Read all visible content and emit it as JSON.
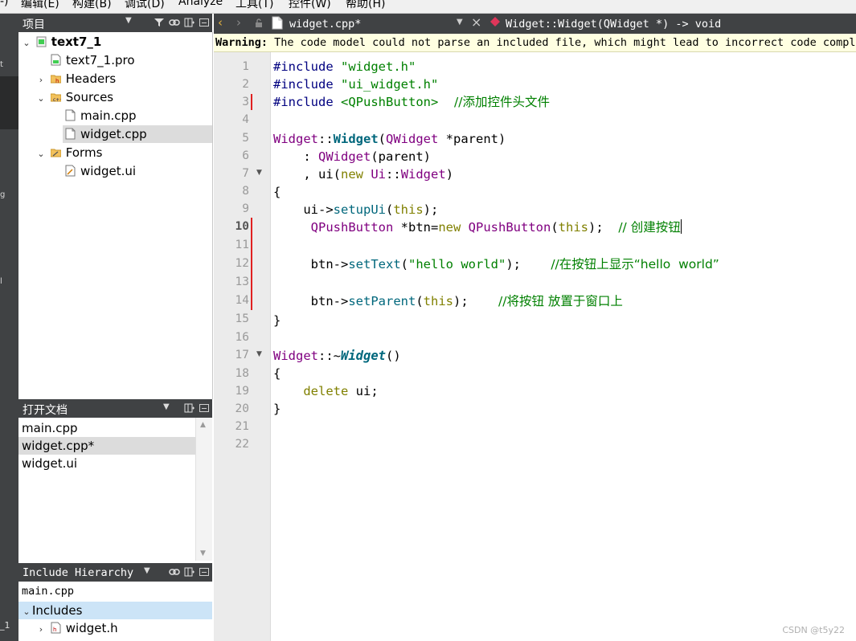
{
  "menu": [
    "-)",
    "编辑(E)",
    "构建(B)",
    "调试(D)",
    "Analyze",
    "工具(T)",
    "控件(W)",
    "帮助(H)"
  ],
  "modebar_fragments": [
    "t",
    "g",
    "l",
    "_1"
  ],
  "project_panel": {
    "title": "项目",
    "tree": [
      {
        "label": "text7_1",
        "bold": true,
        "arrow": "⌄"
      },
      {
        "label": "text7_1.pro",
        "icon": "pro-file-icon"
      },
      {
        "label": "Headers",
        "arrow": "›",
        "icon": "folder-headers-icon"
      },
      {
        "label": "Sources",
        "arrow": "⌄",
        "icon": "folder-sources-icon"
      },
      {
        "label": "main.cpp",
        "icon": "cpp-file-icon"
      },
      {
        "label": "widget.cpp",
        "icon": "cpp-file-icon",
        "selected": true
      },
      {
        "label": "Forms",
        "arrow": "⌄",
        "icon": "folder-forms-icon"
      },
      {
        "label": "widget.ui",
        "icon": "ui-file-icon"
      }
    ]
  },
  "open_docs": {
    "title": "打开文档",
    "items": [
      {
        "label": "main.cpp"
      },
      {
        "label": "widget.cpp*",
        "selected": true
      },
      {
        "label": "widget.ui"
      }
    ]
  },
  "include_hierarchy": {
    "title": "Include Hierarchy",
    "file": "main.cpp",
    "includes_label": "Includes",
    "child": "widget.h"
  },
  "editor": {
    "file_tab": "widget.cpp*",
    "symbol": "Widget::Widget(QWidget *) -> void",
    "warning_bold": "Warning:",
    "warning_text": " The code model could not parse an included file, which might lead to incorrect code completion",
    "current_line": 10,
    "line_numbers": [
      "1",
      "2",
      "3",
      "4",
      "5",
      "6",
      "7",
      "8",
      "9",
      "10",
      "11",
      "12",
      "13",
      "14",
      "15",
      "16",
      "17",
      "18",
      "19",
      "20",
      "21",
      "22"
    ],
    "code": {
      "l1_pp": "#include ",
      "l1_str": "\"widget.h\"",
      "l2_pp": "#include ",
      "l2_str": "\"ui_widget.h\"",
      "l3_pp": "#include ",
      "l3_str": "<QPushButton>",
      "l3_cm": "    //添加控件头文件",
      "l5_ty": "Widget",
      "l5_sep": "::",
      "l5_fn": "Widget",
      "l5_p1": "(",
      "l5_ty2": "QWidget",
      "l5_rest": " *parent)",
      "l6_pre": "    : ",
      "l6_ty": "QWidget",
      "l6_rest": "(parent)",
      "l7_pre": "    , ui(",
      "l7_kw": "new",
      "l7_sp": " ",
      "l7_ty": "Ui",
      "l7_sep": "::",
      "l7_ty2": "Widget",
      "l7_rest": ")",
      "l8": "{",
      "l9_pre": "    ui->",
      "l9_fn": "setupUi",
      "l9_p": "(",
      "l9_kw": "this",
      "l9_rest": ");",
      "l10_pre": "     ",
      "l10_ty": "QPushButton",
      "l10_mid": " *btn=",
      "l10_kw": "new",
      "l10_sp": " ",
      "l10_ty2": "QPushButton",
      "l10_p": "(",
      "l10_kw2": "this",
      "l10_rest": ");  ",
      "l10_cm": "// 创建按钮",
      "l12_pre": "     btn->",
      "l12_fn": "setText",
      "l12_p": "(",
      "l12_str": "\"hello world\"",
      "l12_rest": ");    ",
      "l12_cm": "//在按钮上显示“hello  world”",
      "l14_pre": "     btn->",
      "l14_fn": "setParent",
      "l14_p": "(",
      "l14_kw": "this",
      "l14_rest": ");    ",
      "l14_cm": "//将按钮 放置于窗口上",
      "l15": "}",
      "l17_ty": "Widget",
      "l17_sep": "::~",
      "l17_fn": "Widget",
      "l17_rest": "()",
      "l18": "{",
      "l19_pre": "    ",
      "l19_kw": "delete",
      "l19_rest": " ui;",
      "l20": "}"
    }
  },
  "watermark": "CSDN @t5y22"
}
